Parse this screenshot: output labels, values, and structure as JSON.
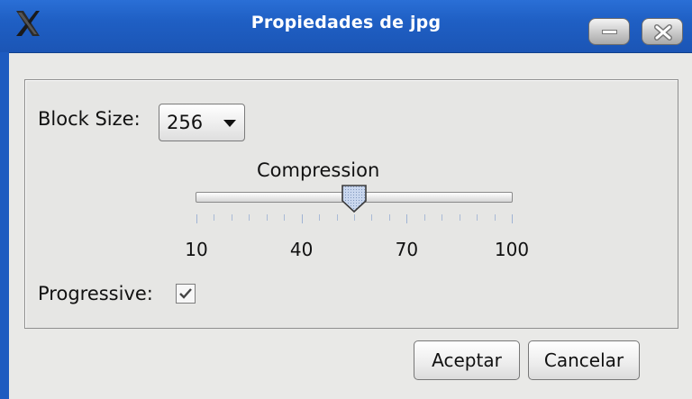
{
  "window": {
    "title": "Propiedades de jpg",
    "app_icon": "x-logo-icon",
    "controls": [
      "minimize-icon",
      "close-icon"
    ]
  },
  "block_size": {
    "label": "Block Size:",
    "value": "256"
  },
  "compression": {
    "label": "Compression",
    "min": 10,
    "max": 100,
    "value": 55,
    "tick_labels": [
      "10",
      "40",
      "70",
      "100"
    ]
  },
  "progressive": {
    "label": "Progressive:",
    "checked": true
  },
  "buttons": {
    "accept": "Aceptar",
    "cancel": "Cancelar"
  },
  "colors": {
    "titlebar": "#1f5fc4",
    "background": "#e9e9e7",
    "slider_thumb": "#c7d5ee"
  }
}
